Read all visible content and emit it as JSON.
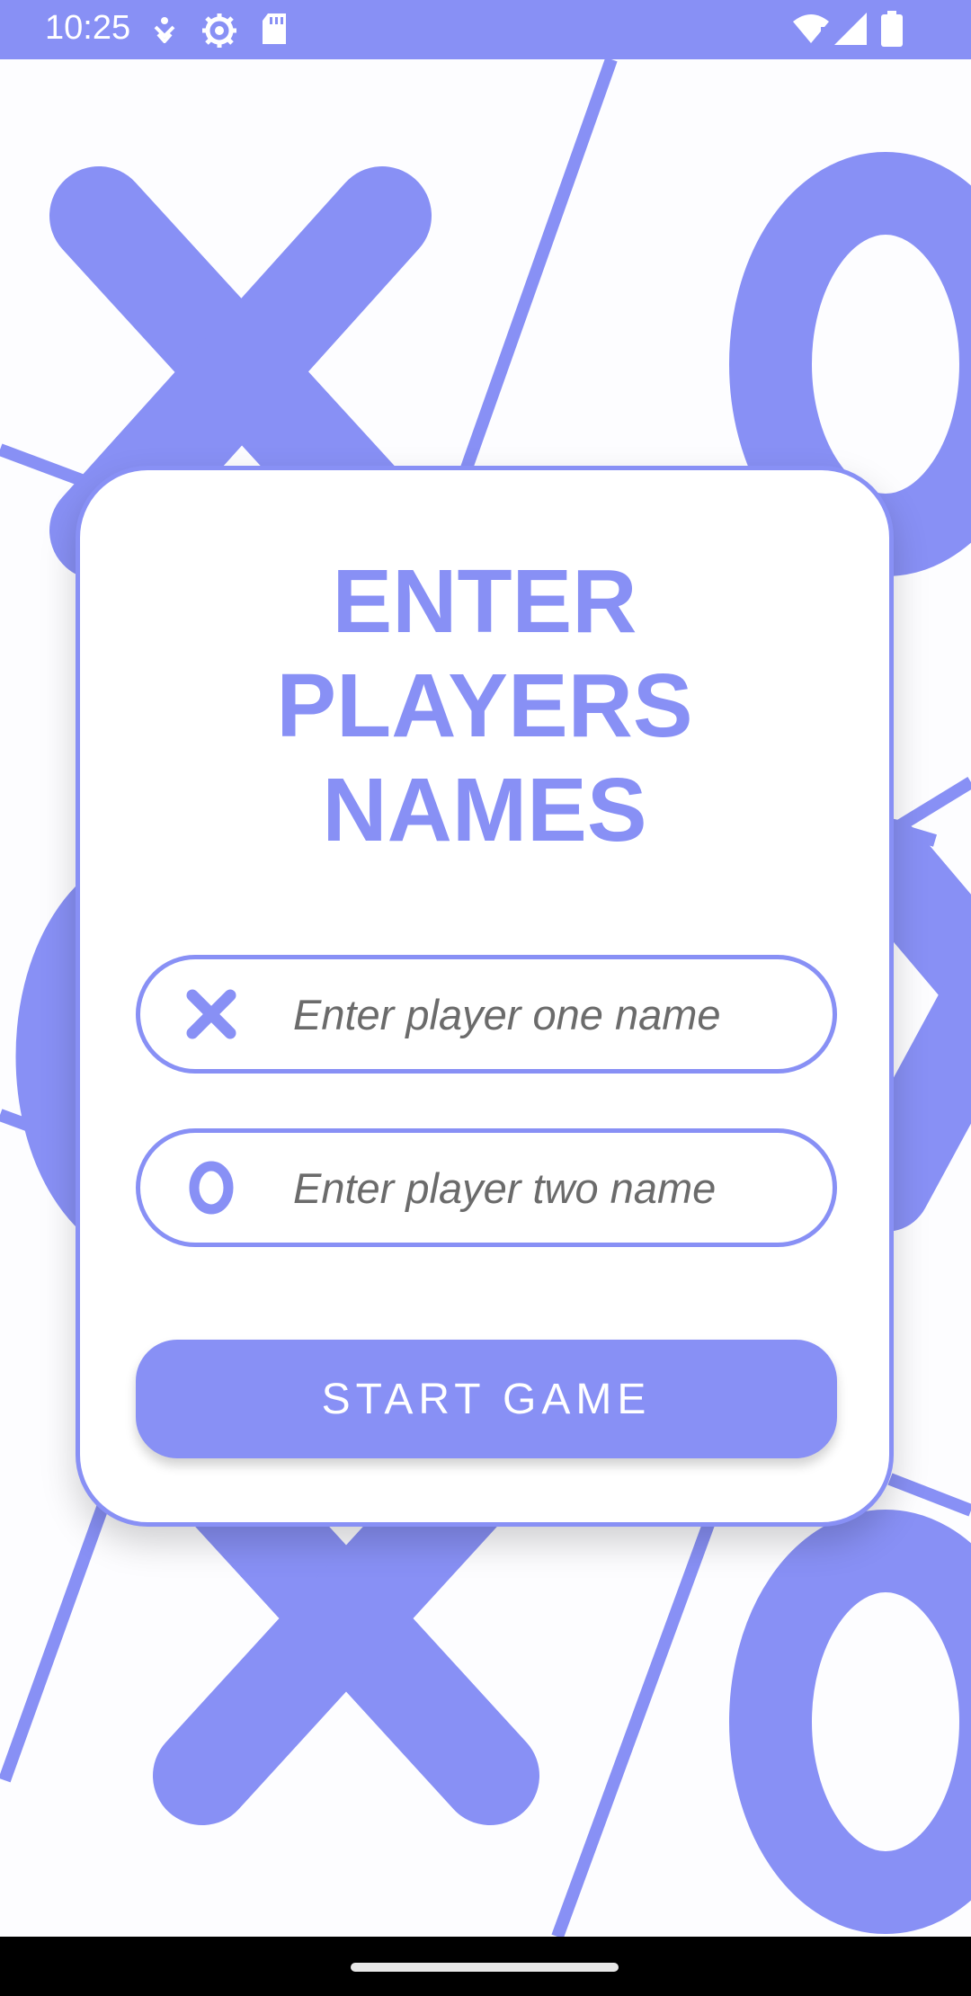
{
  "status_bar": {
    "time": "10:25",
    "icons": [
      "accessibility-icon",
      "settings-gear-icon",
      "sd-card-icon",
      "wifi-alert-icon",
      "signal-icon",
      "battery-icon"
    ]
  },
  "background": {
    "pattern": "tic-tac-toe X and O symbols with diagonal grid lines"
  },
  "card": {
    "title_lines": [
      "ENTER",
      "PLAYERS",
      "NAMES"
    ],
    "player_one": {
      "placeholder": "Enter player one name",
      "value": "",
      "icon": "x-mark-icon"
    },
    "player_two": {
      "placeholder": "Enter player two name",
      "value": "",
      "icon": "o-mark-icon"
    },
    "start_button": "START GAME"
  },
  "colors": {
    "accent": "#8890f5",
    "background": "#fdfdff",
    "text_placeholder": "#6b6b6b",
    "nav_bar": "#000000"
  }
}
